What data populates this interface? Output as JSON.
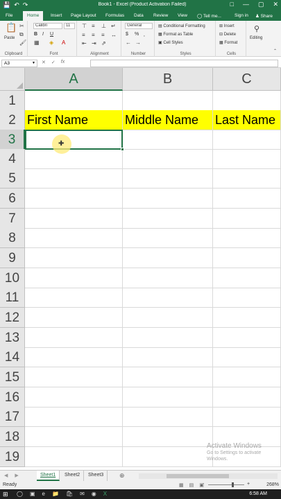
{
  "titlebar": {
    "title": "Book1 - Excel (Product Activation Failed)",
    "save_icon": "💾",
    "undo_icon": "↶",
    "redo_icon": "↷",
    "restore_icon": "□",
    "minimize_icon": "—",
    "maximize_icon": "▢",
    "close_icon": "✕"
  },
  "tabs": {
    "file": "File",
    "home": "Home",
    "insert": "Insert",
    "page_layout": "Page Layout",
    "formulas": "Formulas",
    "data": "Data",
    "review": "Review",
    "view": "View",
    "tell_me": "Tell me...",
    "sign_in": "Sign in",
    "share": "Share"
  },
  "ribbon": {
    "clipboard": {
      "label": "Clipboard",
      "paste": "Paste"
    },
    "font": {
      "label": "Font",
      "name": "Calibri",
      "size": "11",
      "bold": "B",
      "italic": "I",
      "underline": "U"
    },
    "alignment": {
      "label": "Alignment"
    },
    "number": {
      "label": "Number",
      "format": "General",
      "currency": "$",
      "percent": "%"
    },
    "styles": {
      "label": "Styles",
      "conditional_formatting": "Conditional Formatting",
      "format_as_table": "Format as Table",
      "cell_styles": "Cell Styles"
    },
    "cells": {
      "label": "Cells",
      "insert": "Insert",
      "delete": "Delete",
      "format": "Format"
    },
    "editing": {
      "label": "Editing"
    }
  },
  "formula_bar": {
    "name_box": "A3",
    "cancel": "✕",
    "enter": "✓",
    "fx": "fx",
    "value": ""
  },
  "grid": {
    "columns": [
      "A",
      "B",
      "C"
    ],
    "rows": [
      "1",
      "2",
      "3",
      "4",
      "5",
      "6",
      "7",
      "8",
      "9",
      "10",
      "11",
      "12",
      "13",
      "14",
      "15",
      "16",
      "17",
      "18",
      "19"
    ],
    "header_cells": [
      "First Name",
      "Middle Name",
      "Last Name"
    ],
    "header_fill": "#ffff00",
    "active_cell": "A3"
  },
  "watermark": {
    "title": "Activate Windows",
    "subtitle": "Go to Settings to activate Windows."
  },
  "sheets": [
    "Sheet1",
    "Sheet2",
    "Sheet3"
  ],
  "active_sheet": "Sheet1",
  "status": {
    "ready": "Ready",
    "zoom": "268%",
    "zoom_minus": "-",
    "zoom_plus": "+"
  },
  "taskbar": {
    "time": "6:58 AM"
  },
  "colors": {
    "excel_green": "#217346",
    "header_yellow": "#ffff00"
  }
}
